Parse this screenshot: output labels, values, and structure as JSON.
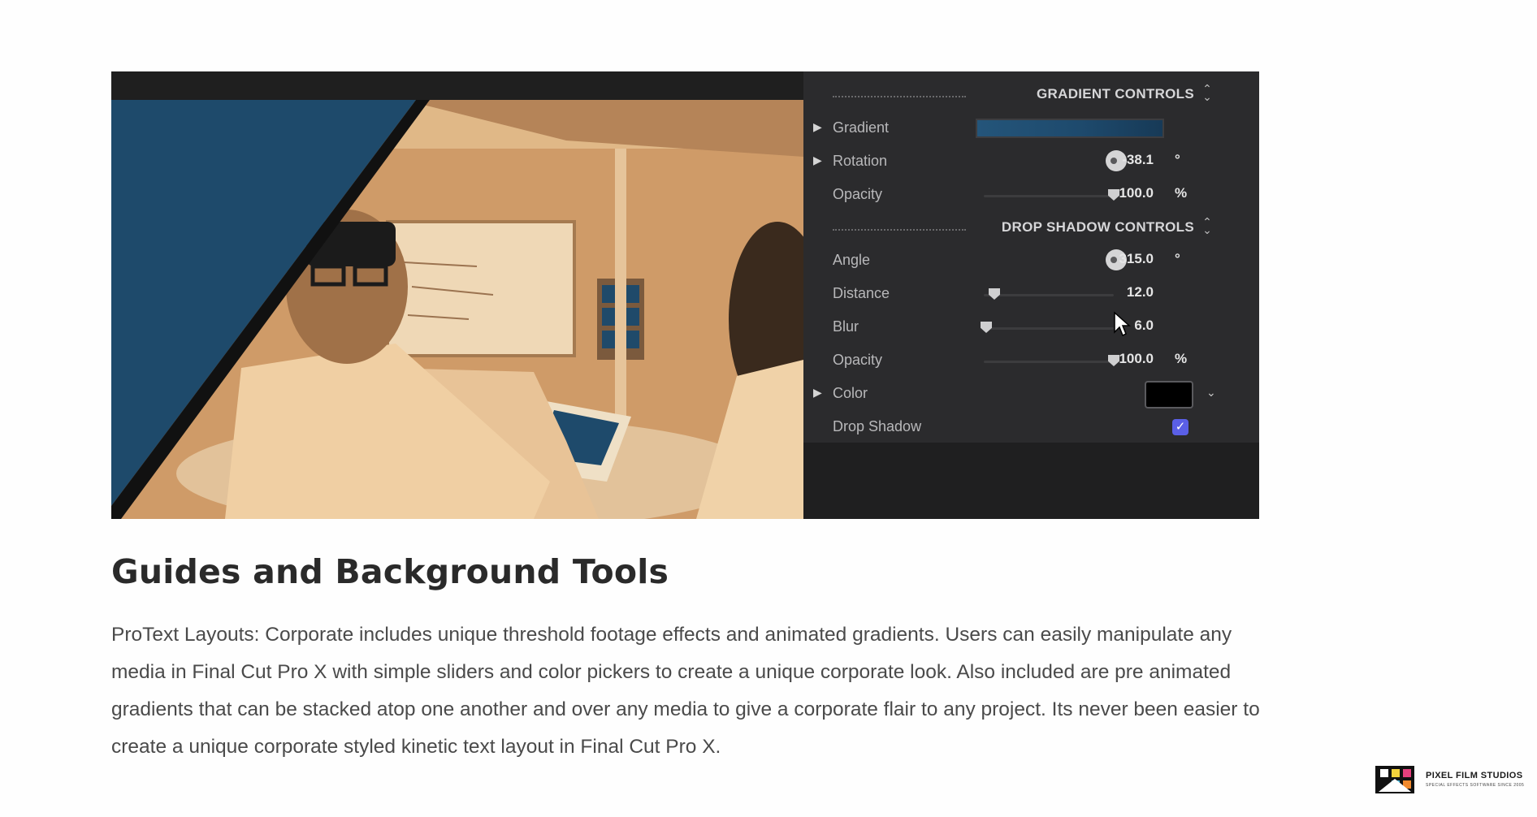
{
  "panel": {
    "gradient_section": {
      "title": "GRADIENT CONTROLS",
      "rows": [
        {
          "label": "Gradient"
        },
        {
          "label": "Rotation",
          "value": "-38.1",
          "unit": "°"
        },
        {
          "label": "Opacity",
          "value": "100.0",
          "unit": "%",
          "level": 1.0
        }
      ]
    },
    "shadow_section": {
      "title": "DROP SHADOW CONTROLS",
      "rows": [
        {
          "label": "Angle",
          "value": "315.0",
          "unit": "°"
        },
        {
          "label": "Distance",
          "value": "12.0",
          "level": 0.12
        },
        {
          "label": "Blur",
          "value": "6.0",
          "level": 0.06
        },
        {
          "label": "Opacity",
          "value": "100.0",
          "unit": "%",
          "level": 1.0
        },
        {
          "label": "Color"
        },
        {
          "label": "Drop Shadow",
          "checked": true
        }
      ]
    },
    "gradient_color_start": "#24557a",
    "gradient_color_end": "#173a57",
    "shadow_color": "#000000",
    "checkbox_color": "#5a5fe6"
  },
  "icons": {
    "expand": "▶",
    "updown": "⌃⌄",
    "chevron_down": "⌄",
    "check": "✓"
  },
  "heading": "Guides and Background Tools",
  "body_text": "ProText Layouts: Corporate includes unique threshold footage effects and animated gradients. Users can easily manipulate any media in Final Cut Pro X with simple sliders and color pickers to create a unique corporate look. Also included are pre animated gradients that can be stacked atop one another and over any media to give a corporate flair to any project. Its never been easier to create a unique corporate styled kinetic text layout in Final Cut Pro X.",
  "logo": {
    "brand": "PIXEL FILM STUDIOS",
    "tagline": "SPECIAL EFFECTS SOFTWARE SINCE 2005"
  },
  "colors": {
    "photo_tint": "#d9a874",
    "overlay_blue": "#1e4a6b",
    "panel_bg": "#2b2b2d"
  }
}
